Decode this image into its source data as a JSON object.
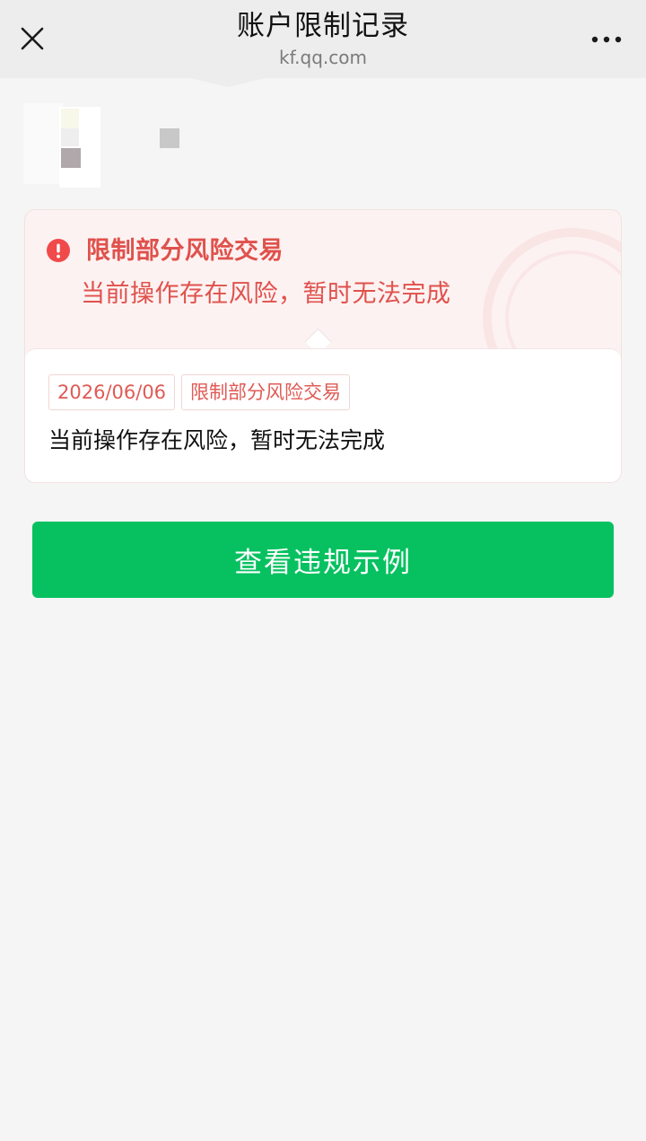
{
  "header": {
    "title": "账户限制记录",
    "url": "kf.qq.com",
    "close_icon": "close-icon",
    "more_icon": "more-icon"
  },
  "account": {
    "avatar_icon": "avatar-blurred"
  },
  "restriction": {
    "icon": "warning-circle-icon",
    "title": "限制部分风险交易",
    "subtitle": "当前操作存在风险，暂时无法完成",
    "accent_color": "#e0514c",
    "records": [
      {
        "date": "2026/06/06",
        "type": "限制部分风险交易",
        "description": "当前操作存在风险，暂时无法完成"
      }
    ]
  },
  "actions": {
    "view_examples_label": "查看违规示例",
    "button_color": "#07c160"
  }
}
